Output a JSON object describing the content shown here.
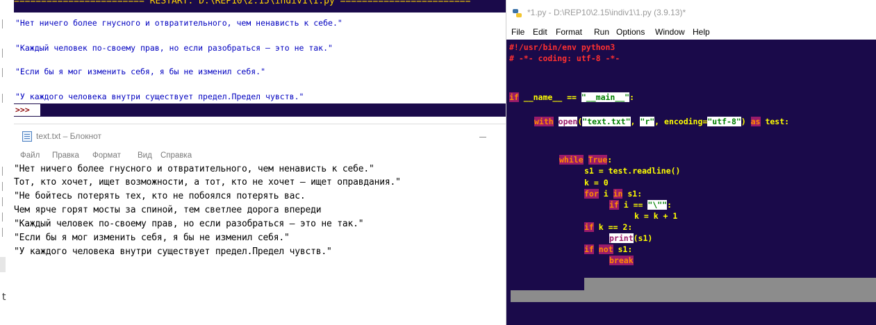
{
  "left_strip": {
    "letter": "t"
  },
  "shell": {
    "restart_line": "======================== RESTART: D:\\REP10\\2.15\\indiv1\\1.py ========================",
    "output_lines": [
      "\"Нет ничего более гнусного и отвратительного, чем ненависть к себе.\"",
      "\"Каждый человек по-своему прав, но если разобраться — это не так.\"",
      "\"Если бы я мог изменить себя, я бы не изменил себя.\"",
      "\"У каждого человека внутри существует предел.Предел чувств.\""
    ],
    "prompt": ">>>"
  },
  "notepad": {
    "title": "text.txt – Блокнот",
    "menu": [
      "Файл",
      "Правка",
      "Формат",
      "Вид",
      "Справка"
    ],
    "lines": [
      "\"Нет ничего более гнусного и отвратительного, чем ненависть к себе.\"",
      "Тот, кто хочет, ищет возможности, а тот, кто не хочет — ищет оправдания.\"",
      "\"Не бойтесь потерять тех, кто не побоялся потерять вас.",
      "Чем ярче горят мосты за спиной, тем светлее дорога впереди",
      "\"Каждый человек по-своему прав, но если разобраться — это не так.\"",
      "\"Если бы я мог изменить себя, я бы не изменил себя.\"",
      "\"У каждого человека внутри существует предел.Предел чувств.\""
    ]
  },
  "editor": {
    "title": "*1.py - D:\\REP10\\2.15\\indiv1\\1.py (3.9.13)*",
    "menu": [
      "File",
      "Edit",
      "Format",
      "Run",
      "Options",
      "Window",
      "Help"
    ],
    "code": {
      "shebang": "#!/usr/bin/env python3",
      "coding": "# -*- coding: utf-8 -*-",
      "kw_if": "if",
      "name_var": " __name__ == ",
      "main_str": "\"__main__\"",
      "colon": ":",
      "kw_with": "with",
      "open_fn": "open",
      "open_args_1": "(",
      "file_str": "\"text.txt\"",
      "comma_1": ", ",
      "mode_str": "\"r\"",
      "enc_kw": ", encoding=",
      "enc_str": "\"utf-8\"",
      "close_paren": ") ",
      "kw_as": "as",
      "as_target": " test:",
      "kw_while": "while",
      "space": " ",
      "kw_true": "True",
      "readline": "s1 = test.readline()",
      "k_init": "k = 0",
      "kw_for": "for",
      "for_var": " i ",
      "kw_in": "in",
      "for_iter": " s1:",
      "cond_eq": " i == ",
      "quote_str": "\"\\\"\"",
      "k_inc": "k = k + 1",
      "cond_k": " k == 2:",
      "print_fn": "print",
      "print_args": "(s1)",
      "kw_not": "not",
      "not_target": " s1:",
      "kw_break": "break"
    }
  },
  "colors": {
    "idle_bg": "#1a0a4a",
    "keyword_bg": "#9a1b6a",
    "keyword_fg": "#ff8c00",
    "string_fg": "#008000",
    "default_code_fg": "#ffff00",
    "comment_fg": "#ff3030",
    "shell_output_fg": "#0000c0"
  }
}
